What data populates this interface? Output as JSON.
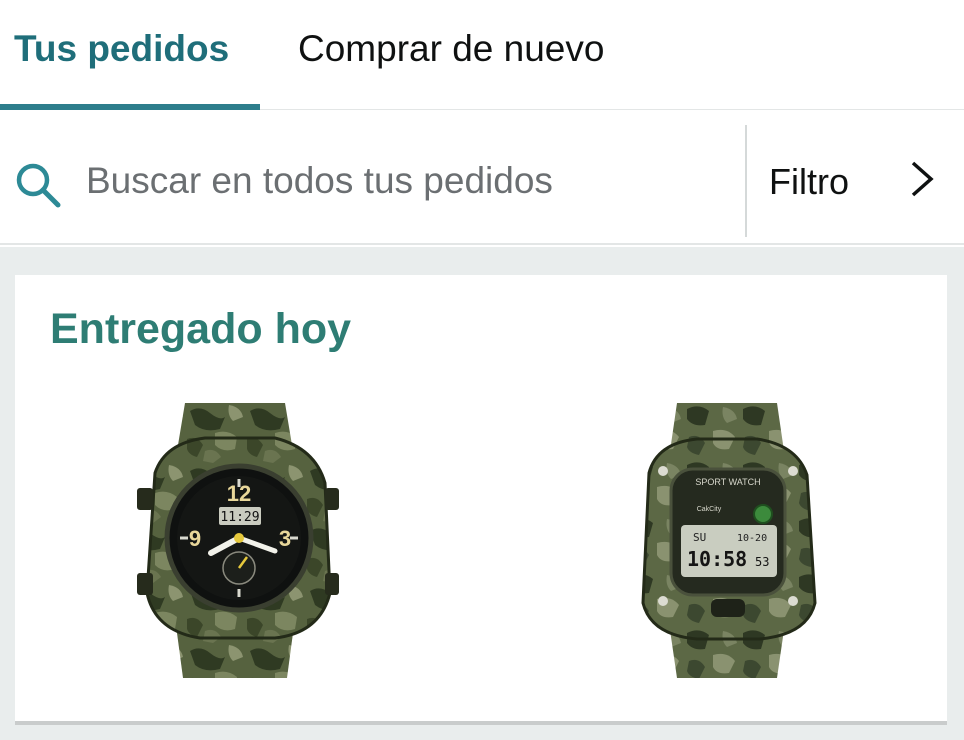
{
  "tabs": [
    {
      "label": "Tus pedidos",
      "active": true
    },
    {
      "label": "Comprar de nuevo",
      "active": false
    }
  ],
  "search": {
    "placeholder": "Buscar en todos tus pedidos",
    "value": "",
    "icon": "search-icon"
  },
  "filter": {
    "label": "Filtro",
    "icon": "chevron-right-icon"
  },
  "order": {
    "status": "Entregado hoy",
    "products": [
      {
        "name": "analog-digital-watch",
        "dial_numbers": [
          "12",
          "9",
          "3"
        ],
        "digital_time": "11:29"
      },
      {
        "name": "digital-sport-watch",
        "bezel_text": "SPORT WATCH",
        "brand": "CakCity",
        "day": "SU",
        "date": "10-20",
        "time": "10:58",
        "seconds": "53"
      }
    ]
  },
  "colors": {
    "accent": "#2d7e8c",
    "status_green": "#2e7d74",
    "camo_base": "#4f5e3c"
  }
}
